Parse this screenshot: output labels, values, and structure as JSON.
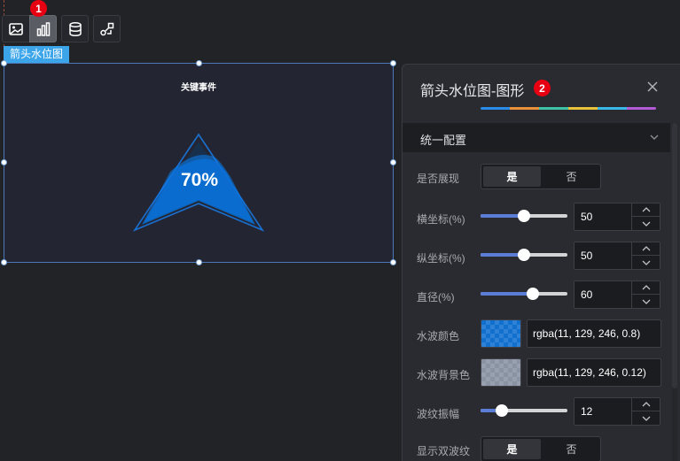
{
  "toolbar": {
    "badge": "1",
    "buttons": [
      {
        "icon": "image-icon"
      },
      {
        "icon": "bar-chart-icon",
        "active": true
      },
      {
        "icon": "database-icon"
      },
      {
        "icon": "link-nodes-icon"
      }
    ]
  },
  "widget": {
    "tag": "箭头水位图",
    "title": "关键事件",
    "percent": "70%",
    "fill_color": "#0b81f6",
    "outline_color": "#1a6fd0"
  },
  "panel": {
    "title": "箭头水位图-图形",
    "badge": "2",
    "tab_colors": [
      "#2a8be8",
      "#e8913a",
      "#3ec4a4",
      "#e8c23a",
      "#3ab8e8",
      "#b35bd6"
    ],
    "section": "统一配置",
    "show": {
      "label": "是否展现",
      "yes": "是",
      "no": "否"
    },
    "x": {
      "label": "横坐标(%)",
      "value": "50",
      "fraction": 0.5
    },
    "y": {
      "label": "纵坐标(%)",
      "value": "50",
      "fraction": 0.5
    },
    "diameter": {
      "label": "直径(%)",
      "value": "60",
      "fraction": 0.6
    },
    "wave_color": {
      "label": "水波颜色",
      "value": "rgba(11, 129, 246, 0.8)",
      "swatch": "rgba(11,129,246,0.8)"
    },
    "wave_bg": {
      "label": "水波背景色",
      "value": "rgba(11, 129, 246, 0.12)",
      "swatch": "rgba(11,129,246,0.12)"
    },
    "amplitude": {
      "label": "波纹振幅",
      "value": "12",
      "fraction": 0.24
    },
    "double_wave": {
      "label": "显示双波纹",
      "yes": "是",
      "no": "否"
    }
  }
}
